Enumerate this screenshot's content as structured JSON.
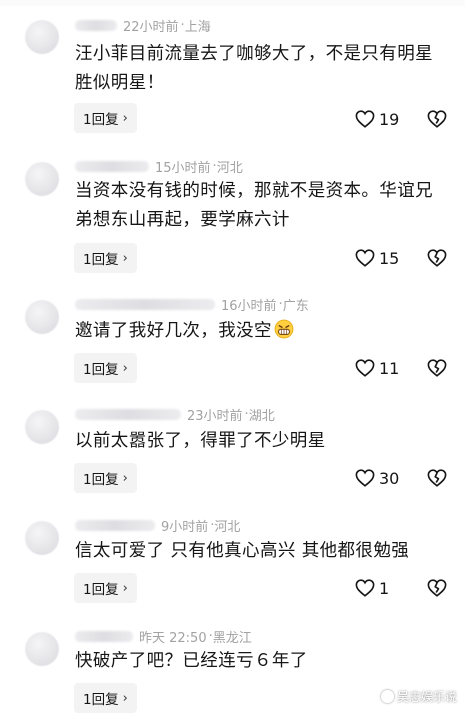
{
  "comments": [
    {
      "time": "22小时前",
      "location": "上海",
      "text": "汪小菲目前流量去了咖够大了，不是只有明星胜似明星！",
      "reply_label": "1回复",
      "likes": "19",
      "emoji": ""
    },
    {
      "time": "15小时前",
      "location": "河北",
      "text": "当资本没有钱的时候，那就不是资本。华谊兄弟想东山再起，要学麻六计",
      "reply_label": "1回复",
      "likes": "15",
      "emoji": ""
    },
    {
      "time": "16小时前",
      "location": "广东",
      "text": "邀请了我好几次，我没空",
      "reply_label": "1回复",
      "likes": "11",
      "emoji": "grinning-face-icon"
    },
    {
      "time": "23小时前",
      "location": "湖北",
      "text": "以前太嚣张了，得罪了不少明星",
      "reply_label": "1回复",
      "likes": "30",
      "emoji": ""
    },
    {
      "time": "9小时前",
      "location": "河北",
      "text": "信太可爱了 只有他真心高兴 其他都很勉强",
      "reply_label": "1回复",
      "likes": "1",
      "emoji": ""
    },
    {
      "time": "昨天 22:50",
      "location": "黑龙江",
      "text": "快破产了吧？已经连亏６年了",
      "reply_label": "1回复",
      "likes": "",
      "emoji": ""
    }
  ],
  "separator": "·",
  "watermark": "吴志娱乐说",
  "icons": {
    "like": "heart-outline-icon",
    "dislike": "broken-heart-icon",
    "reply_chevron": "chevron-right-icon"
  }
}
